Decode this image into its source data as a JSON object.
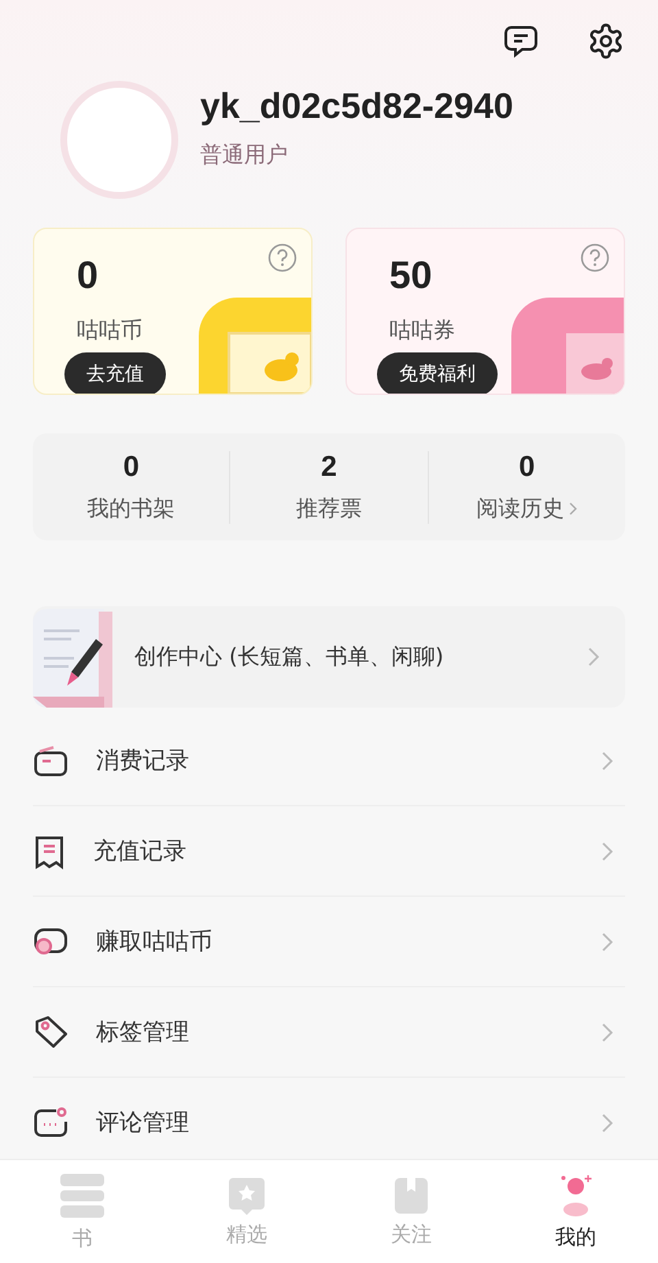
{
  "header": {
    "username": "yk_d02c5d82-2940",
    "user_level": "普通用户"
  },
  "wallet_cards": [
    {
      "kind": "coin",
      "amount": "0",
      "label": "咕咕币",
      "button": "去充值"
    },
    {
      "kind": "ticket",
      "amount": "50",
      "label": "咕咕券",
      "button": "免费福利"
    }
  ],
  "stats": [
    {
      "value": "0",
      "label": "我的书架",
      "link": false
    },
    {
      "value": "2",
      "label": "推荐票",
      "link": false
    },
    {
      "value": "0",
      "label": "阅读历史",
      "link": true
    }
  ],
  "creation_center": {
    "label": "创作中心 (长短篇、书单、闲聊)"
  },
  "menu": [
    {
      "kind": "wallet",
      "label": "消费记录"
    },
    {
      "kind": "receipt",
      "label": "充值记录"
    },
    {
      "kind": "coins",
      "label": "赚取咕咕币"
    },
    {
      "kind": "tag",
      "label": "标签管理"
    },
    {
      "kind": "comment",
      "label": "评论管理"
    }
  ],
  "tabs": [
    {
      "kind": "shelf",
      "label": "书",
      "selected": false
    },
    {
      "kind": "star",
      "label": "精选",
      "selected": false
    },
    {
      "kind": "book",
      "label": "关注",
      "selected": false
    },
    {
      "kind": "me",
      "label": "我的",
      "selected": true
    }
  ]
}
